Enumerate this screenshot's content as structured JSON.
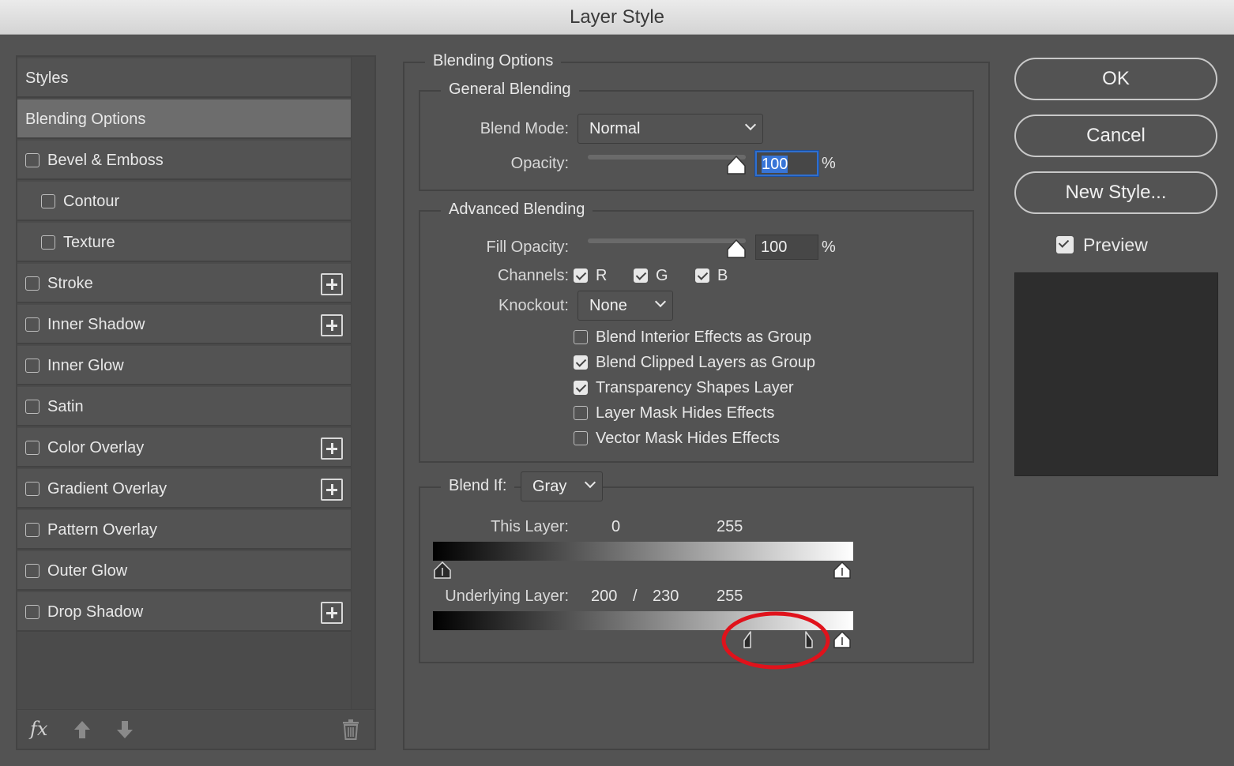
{
  "window": {
    "title": "Layer Style"
  },
  "styles_panel": {
    "items": [
      {
        "label": "Styles",
        "has_checkbox": false,
        "checked": false,
        "has_plus": false,
        "selected": false,
        "indent": 0
      },
      {
        "label": "Blending Options",
        "has_checkbox": false,
        "checked": false,
        "has_plus": false,
        "selected": true,
        "indent": 0
      },
      {
        "label": "Bevel & Emboss",
        "has_checkbox": true,
        "checked": false,
        "has_plus": false,
        "selected": false,
        "indent": 0
      },
      {
        "label": "Contour",
        "has_checkbox": true,
        "checked": false,
        "has_plus": false,
        "selected": false,
        "indent": 1
      },
      {
        "label": "Texture",
        "has_checkbox": true,
        "checked": false,
        "has_plus": false,
        "selected": false,
        "indent": 1
      },
      {
        "label": "Stroke",
        "has_checkbox": true,
        "checked": false,
        "has_plus": true,
        "selected": false,
        "indent": 0
      },
      {
        "label": "Inner Shadow",
        "has_checkbox": true,
        "checked": false,
        "has_plus": true,
        "selected": false,
        "indent": 0
      },
      {
        "label": "Inner Glow",
        "has_checkbox": true,
        "checked": false,
        "has_plus": false,
        "selected": false,
        "indent": 0
      },
      {
        "label": "Satin",
        "has_checkbox": true,
        "checked": false,
        "has_plus": false,
        "selected": false,
        "indent": 0
      },
      {
        "label": "Color Overlay",
        "has_checkbox": true,
        "checked": false,
        "has_plus": true,
        "selected": false,
        "indent": 0
      },
      {
        "label": "Gradient Overlay",
        "has_checkbox": true,
        "checked": false,
        "has_plus": true,
        "selected": false,
        "indent": 0
      },
      {
        "label": "Pattern Overlay",
        "has_checkbox": true,
        "checked": false,
        "has_plus": false,
        "selected": false,
        "indent": 0
      },
      {
        "label": "Outer Glow",
        "has_checkbox": true,
        "checked": false,
        "has_plus": false,
        "selected": false,
        "indent": 0
      },
      {
        "label": "Drop Shadow",
        "has_checkbox": true,
        "checked": false,
        "has_plus": true,
        "selected": false,
        "indent": 0
      }
    ],
    "footer": {
      "fx_label": "fx",
      "move_up_icon": "arrow-up-icon",
      "move_down_icon": "arrow-down-icon",
      "delete_icon": "trash-icon"
    }
  },
  "blending_options": {
    "title": "Blending Options",
    "general": {
      "title": "General Blending",
      "blend_mode_label": "Blend Mode:",
      "blend_mode_value": "Normal",
      "opacity_label": "Opacity:",
      "opacity_value": "100",
      "opacity_unit": "%"
    },
    "advanced": {
      "title": "Advanced Blending",
      "fill_opacity_label": "Fill Opacity:",
      "fill_opacity_value": "100",
      "fill_opacity_unit": "%",
      "channels_label": "Channels:",
      "channels": [
        {
          "label": "R",
          "checked": true
        },
        {
          "label": "G",
          "checked": true
        },
        {
          "label": "B",
          "checked": true
        }
      ],
      "knockout_label": "Knockout:",
      "knockout_value": "None",
      "options": [
        {
          "label": "Blend Interior Effects as Group",
          "checked": false
        },
        {
          "label": "Blend Clipped Layers as Group",
          "checked": true
        },
        {
          "label": "Transparency Shapes Layer",
          "checked": true
        },
        {
          "label": "Layer Mask Hides Effects",
          "checked": false
        },
        {
          "label": "Vector Mask Hides Effects",
          "checked": false
        }
      ]
    },
    "blend_if": {
      "label": "Blend If:",
      "value": "Gray",
      "this_layer": {
        "label": "This Layer:",
        "low": "0",
        "high": "255"
      },
      "underlying_layer": {
        "label": "Underlying Layer:",
        "low_a": "200",
        "separator": "/",
        "low_b": "230",
        "high": "255"
      }
    }
  },
  "buttons": {
    "ok": "OK",
    "cancel": "Cancel",
    "new_style": "New Style..."
  },
  "preview": {
    "label": "Preview",
    "checked": true
  },
  "colors": {
    "highlight_circle": "#e0121b",
    "focus_blue": "#3875d7"
  }
}
